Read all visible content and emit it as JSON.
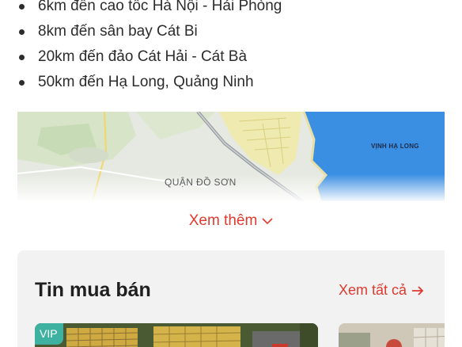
{
  "location": {
    "bullets": [
      "6km đến cao tốc Hà Nội - Hải Phòng",
      "8km đến sân bay Cát Bi",
      "20km đến đảo Cát Hải - Cát Bà",
      "50km đến Hạ Long, Quảng Ninh"
    ],
    "map": {
      "bay_label": "VỊNH HẠ LONG",
      "district_label": "QUẬN ĐỒ SƠN"
    },
    "see_more_label": "Xem thêm"
  },
  "listings": {
    "title": "Tin mua bán",
    "view_all_label": "Xem tất cả",
    "cards": [
      {
        "badge": "VIP"
      },
      {
        "badge": ""
      }
    ]
  },
  "colors": {
    "accent": "#e03a2f",
    "vip_badge": "#3fb1a1",
    "sea": "#3b8fe3",
    "section_bg": "#f2f2f2"
  }
}
